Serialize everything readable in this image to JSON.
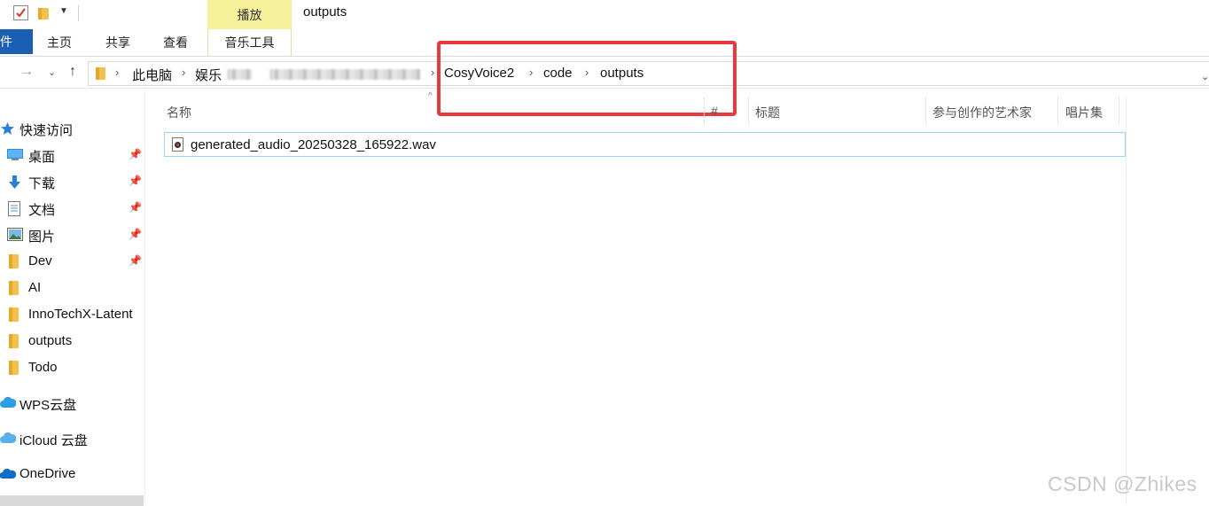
{
  "title_bar": {
    "contextual_tab": "播放",
    "window_title": "outputs"
  },
  "ribbon": {
    "file_tab": "文件",
    "tabs": [
      "主页",
      "共享",
      "查看"
    ],
    "contextual_tab": "音乐工具"
  },
  "address_bar": {
    "crumbs": [
      "此电脑",
      "娱乐",
      "CosyVoice2",
      "code",
      "outputs"
    ]
  },
  "sidebar": {
    "quick_access": "快速访问",
    "pinned": [
      {
        "label": "桌面",
        "icon": "desktop-icon"
      },
      {
        "label": "下载",
        "icon": "download-icon"
      },
      {
        "label": "文档",
        "icon": "document-icon"
      },
      {
        "label": "图片",
        "icon": "picture-icon"
      },
      {
        "label": "Dev",
        "icon": "folder-icon"
      }
    ],
    "folders": [
      "AI",
      "InnoTechX-Latent",
      "outputs",
      "Todo"
    ],
    "clouds": [
      {
        "label": "WPS云盘",
        "icon": "cloud-icon"
      },
      {
        "label": "iCloud 云盘",
        "icon": "icloud-icon"
      },
      {
        "label": "OneDrive",
        "icon": "onedrive-icon"
      }
    ]
  },
  "columns": {
    "name": "名称",
    "number": "#",
    "title": "标题",
    "artist": "参与创作的艺术家",
    "album": "唱片集"
  },
  "files": [
    {
      "name": "generated_audio_20250328_165922.wav",
      "icon": "audio-file-icon"
    }
  ],
  "watermark": "CSDN @Zhikes",
  "colors": {
    "file_tab": "#1a5fb4",
    "contextual_tab": "#f7f19c",
    "highlight": "#e8393e",
    "selection_border": "#99d1ff",
    "folder": "#f2c14e"
  }
}
